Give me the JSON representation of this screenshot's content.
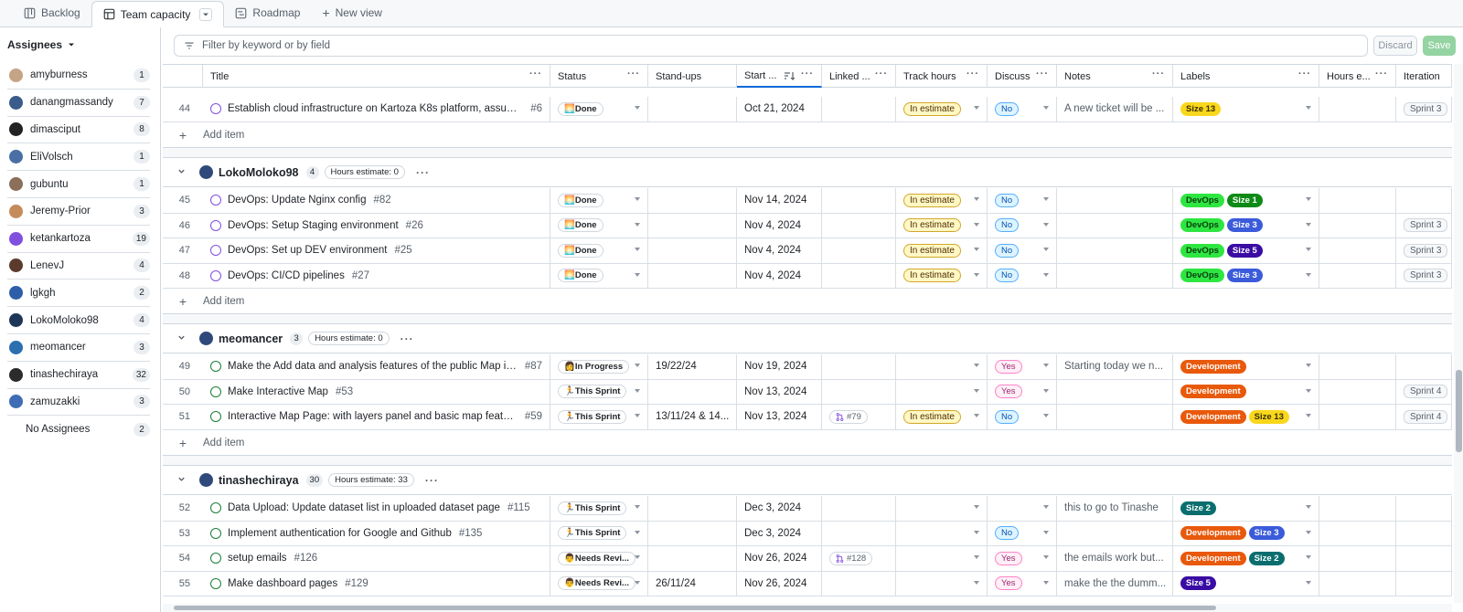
{
  "tabs": [
    {
      "label": "Backlog"
    },
    {
      "label": "Team capacity"
    },
    {
      "label": "Roadmap"
    },
    {
      "label": "New view"
    }
  ],
  "sidebar": {
    "title": "Assignees",
    "items": [
      {
        "name": "amyburness",
        "count": "1",
        "color": "#c4a484"
      },
      {
        "name": "danangmassandy",
        "count": "7",
        "color": "#3b5b8a"
      },
      {
        "name": "dimasciput",
        "count": "8",
        "color": "#222222"
      },
      {
        "name": "EliVolsch",
        "count": "1",
        "color": "#4a6fa5"
      },
      {
        "name": "gubuntu",
        "count": "1",
        "color": "#8b6f5a"
      },
      {
        "name": "Jeremy-Prior",
        "count": "3",
        "color": "#c58b5b"
      },
      {
        "name": "ketankartoza",
        "count": "19",
        "color": "#8250df"
      },
      {
        "name": "LenevJ",
        "count": "4",
        "color": "#5a3a2a"
      },
      {
        "name": "lgkgh",
        "count": "2",
        "color": "#2f5ea8"
      },
      {
        "name": "LokoMoloko98",
        "count": "4",
        "color": "#1d3557"
      },
      {
        "name": "meomancer",
        "count": "3",
        "color": "#2a6fb0"
      },
      {
        "name": "tinashechiraya",
        "count": "32",
        "color": "#2b2b2b"
      },
      {
        "name": "zamuzakki",
        "count": "3",
        "color": "#3e6db5"
      },
      {
        "name": "No Assignees",
        "count": "2",
        "color": ""
      }
    ]
  },
  "filter": {
    "placeholder": "Filter by keyword or by field"
  },
  "actions": {
    "discard": "Discard",
    "save": "Save"
  },
  "columns": [
    "Title",
    "Status",
    "Stand-ups",
    "Start ...",
    "Linked ...",
    "Track hours",
    "Discuss",
    "Notes",
    "Labels",
    "Hours e...",
    "Iteration"
  ],
  "add_item": "Add item",
  "groups": [
    {
      "name": "LokoMoloko98",
      "count": "4",
      "estimate": "Hours estimate: 0"
    },
    {
      "name": "meomancer",
      "count": "3",
      "estimate": "Hours estimate: 0"
    },
    {
      "name": "tinashechiraya",
      "count": "30",
      "estimate": "Hours estimate: 33"
    }
  ],
  "rows": [
    {
      "num": "44",
      "title": "Establish cloud infrastructure on Kartoza K8s platform, assumin...",
      "issue": "#6",
      "state": "closed",
      "status": "🌅Done",
      "standup": "",
      "start": "Oct 21, 2024",
      "linked": "",
      "track": "In estimate",
      "discuss": "No",
      "notes": "A new ticket will be ...",
      "labels": [
        {
          "text": "Size 13",
          "bg": "#f9d71c",
          "fg": "#3a2e00"
        }
      ],
      "iteration": "Sprint 3"
    },
    {
      "num": "45",
      "title": "DevOps: Update Nginx config",
      "issue": "#82",
      "state": "closed",
      "status": "🌅Done",
      "standup": "",
      "start": "Nov 14, 2024",
      "linked": "",
      "track": "In estimate",
      "discuss": "No",
      "notes": "",
      "labels": [
        {
          "text": "DevOps",
          "bg": "#2ee641",
          "fg": "#0b3d11"
        },
        {
          "text": "Size 1",
          "bg": "#0e8a16",
          "fg": "#ffffff"
        }
      ],
      "iteration": ""
    },
    {
      "num": "46",
      "title": "DevOps: Setup Staging environment",
      "issue": "#26",
      "state": "closed",
      "status": "🌅Done",
      "standup": "",
      "start": "Nov 4, 2024",
      "linked": "",
      "track": "In estimate",
      "discuss": "No",
      "notes": "",
      "labels": [
        {
          "text": "DevOps",
          "bg": "#2ee641",
          "fg": "#0b3d11"
        },
        {
          "text": "Size 3",
          "bg": "#3b5bdb",
          "fg": "#ffffff"
        }
      ],
      "iteration": "Sprint 3"
    },
    {
      "num": "47",
      "title": "DevOps: Set up DEV environment",
      "issue": "#25",
      "state": "closed",
      "status": "🌅Done",
      "standup": "",
      "start": "Nov 4, 2024",
      "linked": "",
      "track": "In estimate",
      "discuss": "No",
      "notes": "",
      "labels": [
        {
          "text": "DevOps",
          "bg": "#2ee641",
          "fg": "#0b3d11"
        },
        {
          "text": "Size 5",
          "bg": "#3a0ca3",
          "fg": "#ffffff"
        }
      ],
      "iteration": "Sprint 3"
    },
    {
      "num": "48",
      "title": "DevOps: CI/CD pipelines",
      "issue": "#27",
      "state": "closed",
      "status": "🌅Done",
      "standup": "",
      "start": "Nov 4, 2024",
      "linked": "",
      "track": "In estimate",
      "discuss": "No",
      "notes": "",
      "labels": [
        {
          "text": "DevOps",
          "bg": "#2ee641",
          "fg": "#0b3d11"
        },
        {
          "text": "Size 3",
          "bg": "#3b5bdb",
          "fg": "#ffffff"
        }
      ],
      "iteration": "Sprint 3"
    },
    {
      "num": "49",
      "title": "Make the Add data and analysis features of the public Map inac...",
      "issue": "#87",
      "state": "open",
      "status": "👩In Progress",
      "standup": "19/22/24",
      "start": "Nov 19, 2024",
      "linked": "",
      "track": "",
      "discuss": "Yes",
      "notes": "Starting today we n...",
      "labels": [
        {
          "text": "Development",
          "bg": "#e8590c",
          "fg": "#ffffff"
        }
      ],
      "iteration": ""
    },
    {
      "num": "50",
      "title": "Make Interactive Map",
      "issue": "#53",
      "state": "open",
      "status": "🏃This Sprint",
      "standup": "",
      "start": "Nov 13, 2024",
      "linked": "",
      "track": "",
      "discuss": "Yes",
      "notes": "",
      "labels": [
        {
          "text": "Development",
          "bg": "#e8590c",
          "fg": "#ffffff"
        }
      ],
      "iteration": "Sprint 4"
    },
    {
      "num": "51",
      "title": "Interactive Map Page: with layers panel and basic map features",
      "issue": "#59",
      "state": "open",
      "status": "🏃This Sprint",
      "standup": "13/11/24 & 14...",
      "start": "Nov 13, 2024",
      "linked": "#79",
      "track": "In estimate",
      "discuss": "No",
      "notes": "",
      "labels": [
        {
          "text": "Development",
          "bg": "#e8590c",
          "fg": "#ffffff"
        },
        {
          "text": "Size 13",
          "bg": "#f9d71c",
          "fg": "#3a2e00"
        }
      ],
      "iteration": "Sprint 4"
    },
    {
      "num": "52",
      "title": "Data Upload: Update dataset list in uploaded dataset page",
      "issue": "#115",
      "state": "open",
      "status": "🏃This Sprint",
      "standup": "",
      "start": "Dec 3, 2024",
      "linked": "",
      "track": "",
      "discuss": "",
      "notes": "this to go to Tinashe",
      "labels": [
        {
          "text": "Size 2",
          "bg": "#0b6e6e",
          "fg": "#ffffff"
        }
      ],
      "iteration": ""
    },
    {
      "num": "53",
      "title": "Implement authentication for Google and Github",
      "issue": "#135",
      "state": "open",
      "status": "🏃This Sprint",
      "standup": "",
      "start": "Dec 3, 2024",
      "linked": "",
      "track": "",
      "discuss": "No",
      "notes": "",
      "labels": [
        {
          "text": "Development",
          "bg": "#e8590c",
          "fg": "#ffffff"
        },
        {
          "text": "Size 3",
          "bg": "#3b5bdb",
          "fg": "#ffffff"
        }
      ],
      "iteration": ""
    },
    {
      "num": "54",
      "title": "setup emails",
      "issue": "#126",
      "state": "open",
      "status": "👨Needs Revi...",
      "standup": "",
      "start": "Nov 26, 2024",
      "linked": "#128",
      "track": "",
      "discuss": "Yes",
      "notes": "the emails work but...",
      "labels": [
        {
          "text": "Development",
          "bg": "#e8590c",
          "fg": "#ffffff"
        },
        {
          "text": "Size 2",
          "bg": "#0b6e6e",
          "fg": "#ffffff"
        }
      ],
      "iteration": ""
    },
    {
      "num": "55",
      "title": "Make dashboard pages",
      "issue": "#129",
      "state": "open",
      "status": "👨Needs Revi...",
      "standup": "26/11/24",
      "start": "Nov 26, 2024",
      "linked": "",
      "track": "",
      "discuss": "Yes",
      "notes": "make the the dumm...",
      "labels": [
        {
          "text": "Size 5",
          "bg": "#3a0ca3",
          "fg": "#ffffff"
        }
      ],
      "iteration": ""
    }
  ]
}
